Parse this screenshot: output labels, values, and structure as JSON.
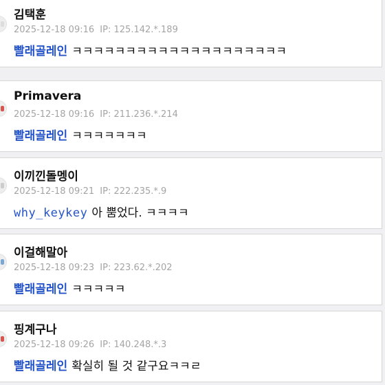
{
  "comments": [
    {
      "nickname": "김택훈",
      "date": "2025-12-18 09:16",
      "ip_label": "IP:",
      "ip": "125.142.*.189",
      "mention": "빨래골레인",
      "text": "ㅋㅋㅋㅋㅋㅋㅋㅋㅋㅋㅋㅋㅋㅋㅋㅋㅋㅋㅋㅋ",
      "avatar_color": "#dddddd"
    },
    {
      "nickname": "Primavera",
      "date": "2025-12-18 09:16",
      "ip_label": "IP:",
      "ip": "211.236.*.214",
      "mention": "빨래골레인",
      "text": "ㅋㅋㅋㅋㅋㅋㅋ",
      "avatar_color": "#d9534f"
    },
    {
      "nickname": "이끼낀돌멩이",
      "date": "2025-12-18 09:21",
      "ip_label": "IP:",
      "ip": "222.235.*.9",
      "mention": "why_keykey",
      "text": "아 뿜었다. ㅋㅋㅋㅋ",
      "avatar_color": "#cccccc"
    },
    {
      "nickname": "이걸해말아",
      "date": "2025-12-18 09:23",
      "ip_label": "IP:",
      "ip": "223.62.*.202",
      "mention": "빨래골레인",
      "text": "ㅋㅋㅋㅋㅋ",
      "avatar_color": "#7aa7d6"
    },
    {
      "nickname": "핑계구나",
      "date": "2025-12-18 09:26",
      "ip_label": "IP:",
      "ip": "140.248.*.3",
      "mention": "빨래골레인",
      "text": "확실히 될 것 같구요ㅋㅋㄹ",
      "avatar_color": "#d9534f"
    }
  ]
}
